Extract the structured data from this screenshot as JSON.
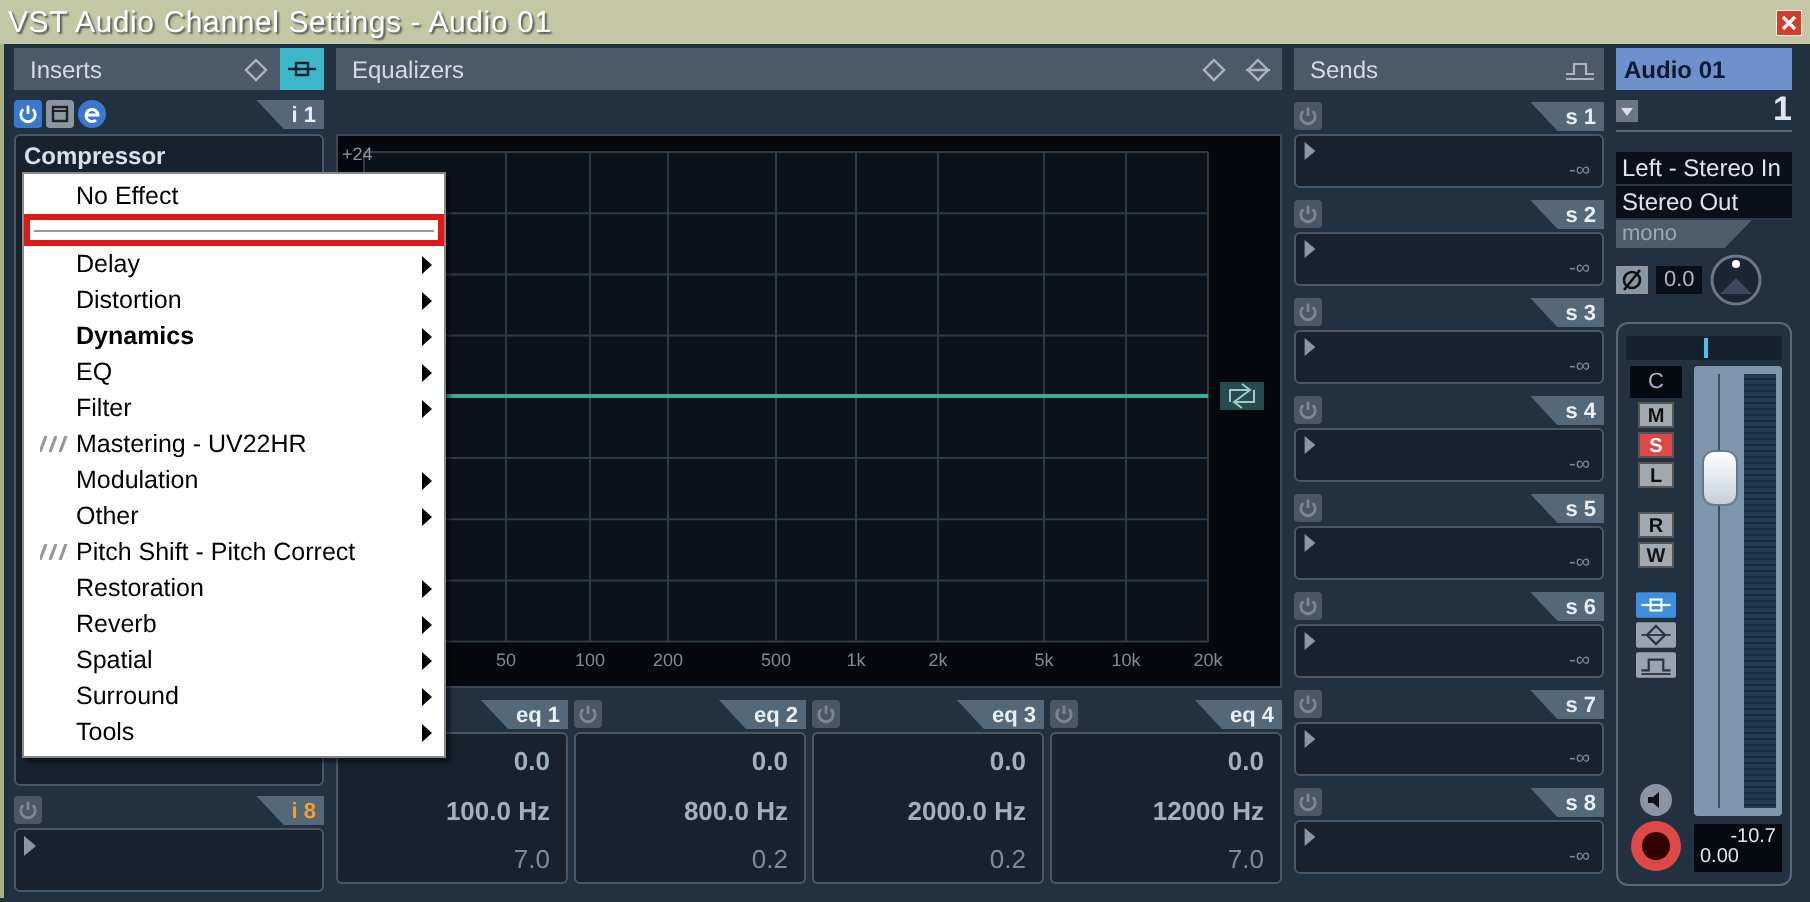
{
  "window": {
    "title": "VST Audio Channel Settings - Audio 01"
  },
  "inserts": {
    "title": "Inserts",
    "first_slot": {
      "tag": "i 1",
      "plugin": "Compressor"
    },
    "last_slot": {
      "tag": "i 8"
    }
  },
  "menu": {
    "items": [
      {
        "kind": "plain",
        "label": "No Effect",
        "current": false
      },
      {
        "kind": "separator",
        "highlighted": true
      },
      {
        "kind": "folder",
        "label": "Delay",
        "current": false
      },
      {
        "kind": "folder",
        "label": "Distortion",
        "current": false
      },
      {
        "kind": "folder",
        "label": "Dynamics",
        "current": true
      },
      {
        "kind": "folder",
        "label": "EQ",
        "current": false
      },
      {
        "kind": "folder",
        "label": "Filter",
        "current": false
      },
      {
        "kind": "plugin",
        "label": "Mastering - UV22HR",
        "current": false
      },
      {
        "kind": "folder",
        "label": "Modulation",
        "current": false
      },
      {
        "kind": "folder",
        "label": "Other",
        "current": false
      },
      {
        "kind": "plugin",
        "label": "Pitch Shift - Pitch Correct",
        "current": false
      },
      {
        "kind": "folder",
        "label": "Restoration",
        "current": false
      },
      {
        "kind": "folder",
        "label": "Reverb",
        "current": false
      },
      {
        "kind": "folder",
        "label": "Spatial",
        "current": false
      },
      {
        "kind": "folder",
        "label": "Surround",
        "current": false
      },
      {
        "kind": "folder",
        "label": "Tools",
        "current": false
      }
    ]
  },
  "equalizer": {
    "title": "Equalizers",
    "graph": {
      "y_label": "+24",
      "x_labels": [
        "50",
        "100",
        "200",
        "500",
        "1k",
        "2k",
        "5k",
        "10k",
        "20k"
      ]
    },
    "bands": [
      {
        "tag": "eq 1",
        "gain": "0.0",
        "frequency": "100.0 Hz",
        "q": "7.0"
      },
      {
        "tag": "eq 2",
        "gain": "0.0",
        "frequency": "800.0 Hz",
        "q": "0.2"
      },
      {
        "tag": "eq 3",
        "gain": "0.0",
        "frequency": "2000.0 Hz",
        "q": "0.2"
      },
      {
        "tag": "eq 4",
        "gain": "0.0",
        "frequency": "12000 Hz",
        "q": "7.0"
      }
    ]
  },
  "sends": {
    "title": "Sends",
    "slots": [
      {
        "tag": "s 1",
        "value": "-∞"
      },
      {
        "tag": "s 2",
        "value": "-∞"
      },
      {
        "tag": "s 3",
        "value": "-∞"
      },
      {
        "tag": "s 4",
        "value": "-∞"
      },
      {
        "tag": "s 5",
        "value": "-∞"
      },
      {
        "tag": "s 6",
        "value": "-∞"
      },
      {
        "tag": "s 7",
        "value": "-∞"
      },
      {
        "tag": "s 8",
        "value": "-∞"
      }
    ]
  },
  "channel": {
    "name": "Audio 01",
    "number": "1",
    "input": "Left - Stereo In",
    "output": "Stereo Out",
    "panner_mode": "mono",
    "phase": "0.0",
    "pan": "C",
    "buttons": [
      {
        "label": "M",
        "on": false
      },
      {
        "label": "S",
        "on": true
      },
      {
        "label": "L",
        "on": false
      },
      {
        "label": "R",
        "on": false
      },
      {
        "label": "W",
        "on": false
      }
    ],
    "routing": [
      {
        "kind": "inserts",
        "on": true
      },
      {
        "kind": "equalizers",
        "on": false
      },
      {
        "kind": "sends",
        "on": false
      }
    ],
    "fader": {
      "level": 0.76
    },
    "meter_peak": "-10.7",
    "volume": "0.00"
  }
}
